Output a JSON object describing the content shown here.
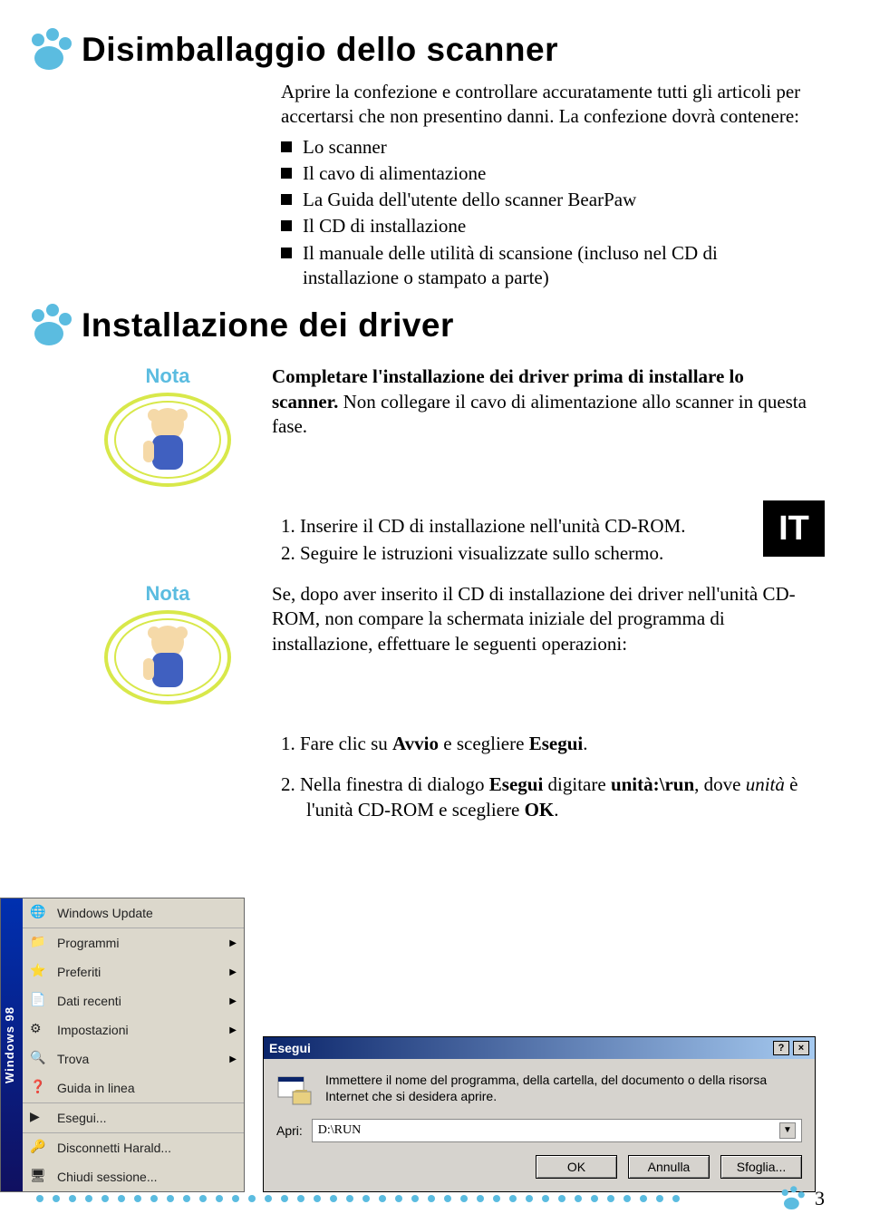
{
  "section1": {
    "title": "Disimballaggio dello scanner",
    "intro": "Aprire la confezione e controllare accuratamente tutti gli articoli per accertarsi che non presentino danni. La confezione dovrà contenere:",
    "items": [
      "Lo scanner",
      "Il cavo di alimentazione",
      "La Guida dell'utente dello scanner BearPaw",
      "Il CD di installazione",
      "Il manuale delle utilità di scansione (incluso nel CD di installazione o stampato a parte)"
    ]
  },
  "section2": {
    "title": "Installazione dei driver",
    "nota_label": "Nota",
    "nota1_bold": "Completare l'installazione dei driver prima di installare lo scanner.",
    "nota1_rest": " Non collegare il cavo di alimentazione allo scanner in questa fase.",
    "step1": "1. Inserire il CD di installazione nell'unità CD-ROM.",
    "step2": "2. Seguire le istruzioni visualizzate sullo schermo.",
    "nota2": "Se, dopo aver inserito il CD di installazione dei driver nell'unità CD-ROM, non compare la schermata iniziale del programma di installazione, effettuare le seguenti operazioni:",
    "step3_pre": "1. Fare clic su ",
    "step3_b1": "Avvio",
    "step3_mid": " e scegliere ",
    "step3_b2": "Esegui",
    "step3_end": ".",
    "step4_pre": "2. Nella finestra di dialogo ",
    "step4_b1": "Esegui",
    "step4_mid1": " digitare ",
    "step4_b2": "unità:\\run",
    "step4_mid2": ", dove ",
    "step4_i": "unità",
    "step4_mid3": " è l'unità CD-ROM e scegliere ",
    "step4_b3": "OK",
    "step4_end": "."
  },
  "lang_badge": "IT",
  "start_menu": {
    "brand": "Windows 98",
    "items": [
      {
        "label": "Windows Update"
      },
      {
        "label": "Programmi"
      },
      {
        "label": "Preferiti"
      },
      {
        "label": "Dati recenti"
      },
      {
        "label": "Impostazioni"
      },
      {
        "label": "Trova"
      },
      {
        "label": "Guida in linea"
      },
      {
        "label": "Esegui..."
      },
      {
        "label": "Disconnetti Harald..."
      },
      {
        "label": "Chiudi sessione..."
      }
    ]
  },
  "run_dialog": {
    "title": "Esegui",
    "text": "Immettere il nome del programma, della cartella, del documento o della risorsa Internet che si desidera aprire.",
    "label": "Apri:",
    "value": "D:\\RUN",
    "buttons": {
      "ok": "OK",
      "cancel": "Annulla",
      "browse": "Sfoglia..."
    }
  },
  "page_number": "3"
}
